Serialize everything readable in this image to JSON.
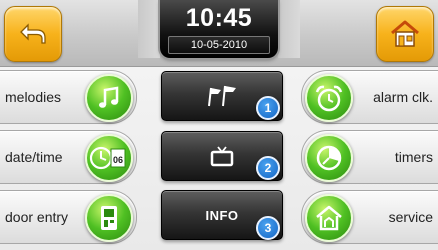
{
  "header": {
    "time": "10:45",
    "date": "10-05-2010"
  },
  "menu": {
    "left": [
      {
        "label": "melodies",
        "icon": "music-note-icon"
      },
      {
        "label": "date/time",
        "icon": "clock-calendar-icon"
      },
      {
        "label": "door entry",
        "icon": "door-entry-icon"
      }
    ],
    "right": [
      {
        "label": "alarm clk.",
        "icon": "alarm-clock-icon"
      },
      {
        "label": "timers",
        "icon": "timer-icon"
      },
      {
        "label": "service",
        "icon": "service-house-icon"
      }
    ],
    "center": [
      {
        "badge": "1",
        "icon": "flags-icon"
      },
      {
        "badge": "2",
        "icon": "tv-icon"
      },
      {
        "badge": "3",
        "label": "INFO"
      }
    ]
  },
  "icon_badge_text": "06",
  "colors": {
    "accent_orange": "#f7b21b",
    "icon_green": "#4fc023",
    "badge_blue": "#1364c4",
    "dark_button": "#353535"
  }
}
